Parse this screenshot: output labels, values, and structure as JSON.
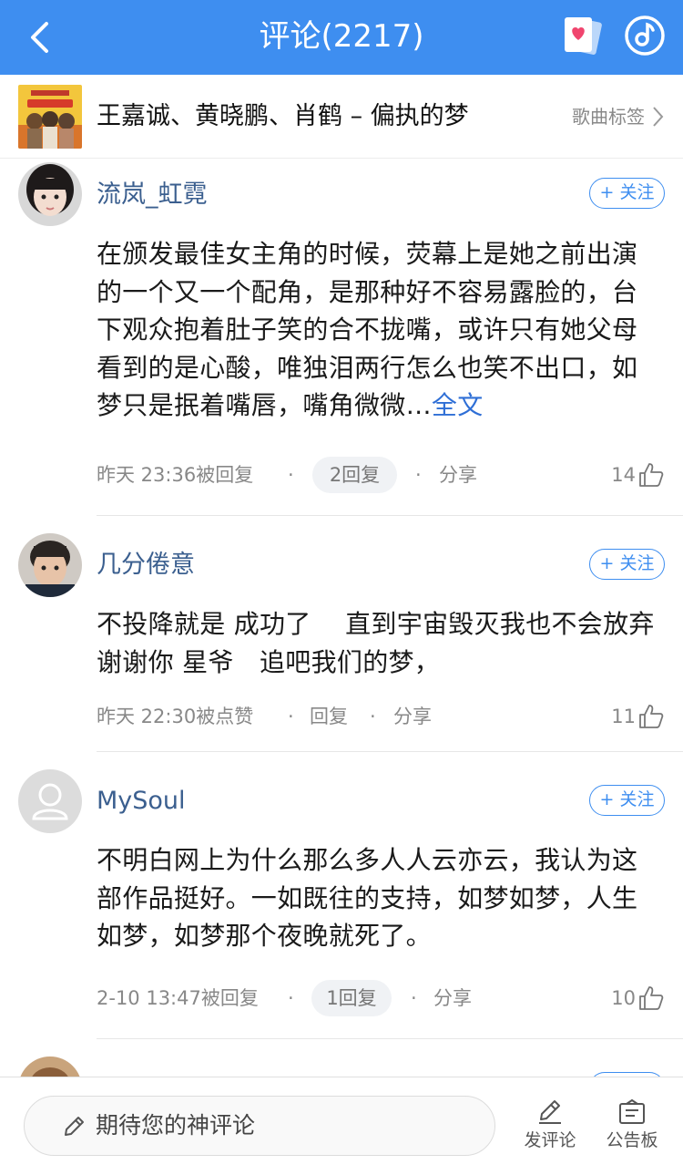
{
  "header": {
    "title": "评论(2217)"
  },
  "song": {
    "title": "王嘉诚、黄晓鹏、肖鹤 – 偏执的梦",
    "tag_label": "歌曲标签"
  },
  "follow_label": "+ 关注",
  "comments": [
    {
      "username": "流岚_虹霓",
      "text": "在颁发最佳女主角的时候，荧幕上是她之前出演的一个又一个配角，是那种好不容易露脸的，台下观众抱着肚子笑的合不拢嘴，或许只有她父母看到的是心酸，唯独泪两行怎么也笑不出口，如梦只是抿着嘴唇，嘴角微微…",
      "full_text_label": "全文",
      "time": "昨天 23:36被回复",
      "replies": "2回复",
      "share": "分享",
      "likes": "14"
    },
    {
      "username": "几分倦意",
      "text": "不投降就是 成功了　 直到宇宙毁灭我也不会放弃 谢谢你 星爷　追吧我们的梦，",
      "time": "昨天 22:30被点赞",
      "reply": "回复",
      "share": "分享",
      "likes": "11"
    },
    {
      "username": "MySoul",
      "text": "不明白网上为什么那么多人人云亦云，我认为这部作品挺好。一如既往的支持，如梦如梦，人生如梦，如梦那个夜晚就死了。",
      "time": "2-10 13:47被回复",
      "replies": "1回复",
      "share": "分享",
      "likes": "10"
    }
  ],
  "separator": "·",
  "bottom": {
    "placeholder": "期待您的神评论",
    "post_label": "发评论",
    "board_label": "公告板"
  },
  "colors": {
    "brand": "#3e8ef0",
    "username": "#3b5f8f",
    "link": "#2f6fd6"
  }
}
